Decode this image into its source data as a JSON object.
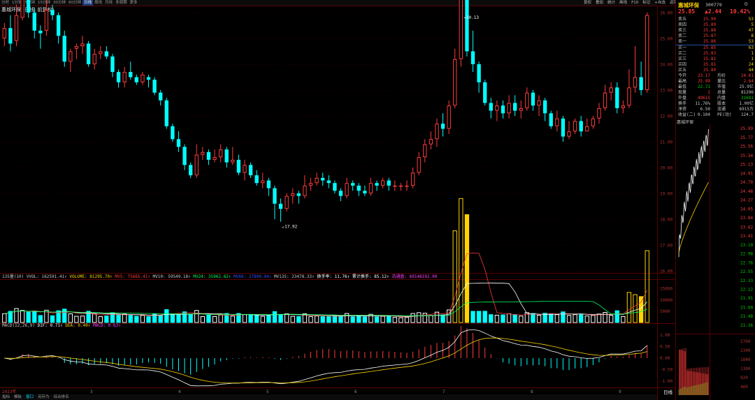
{
  "topbar": {
    "tabs": [
      "分时",
      "1分钟",
      "5分钟",
      "15分钟",
      "30分钟",
      "60分钟",
      "日线",
      "周线",
      "月线",
      "多周期",
      "更多"
    ],
    "active_tab": "日线",
    "right": [
      "复权",
      "叠加",
      "统计",
      "画线",
      "F10",
      "标记",
      "+自选",
      "返回"
    ]
  },
  "title": "惠城环保 (日线, 前复权)",
  "kline": {
    "type": "candlestick",
    "price_axis": [
      "26.00",
      "25.00",
      "24.00",
      "23.00",
      "22.00",
      "21.00",
      "20.00",
      "19.00",
      "18.00",
      "17.00",
      "16.00"
    ],
    "price_range": [
      16,
      26
    ],
    "high_label": "30.13",
    "low_label": "17.92",
    "up_color": "#ff3b3b",
    "down_color": "#00ffff",
    "candles": [
      [
        25.0,
        25.4,
        25.6,
        24.7
      ],
      [
        25.4,
        24.8,
        25.9,
        24.5
      ],
      [
        24.9,
        25.9,
        26.3,
        24.7
      ],
      [
        25.8,
        26.6,
        27.0,
        25.7
      ],
      [
        26.6,
        26.0,
        26.9,
        25.8
      ],
      [
        26.0,
        25.3,
        26.2,
        25.0
      ],
      [
        25.3,
        25.2,
        25.5,
        24.6
      ],
      [
        25.3,
        26.1,
        26.5,
        25.1
      ],
      [
        26.1,
        25.9,
        26.3,
        25.7
      ],
      [
        25.9,
        25.1,
        26.0,
        24.8
      ],
      [
        25.1,
        24.1,
        25.3,
        23.9
      ],
      [
        24.1,
        24.5,
        24.6,
        23.7
      ],
      [
        24.6,
        24.7,
        24.8,
        24.2
      ],
      [
        24.7,
        24.8,
        25.1,
        24.4
      ],
      [
        24.8,
        24.0,
        24.9,
        23.9
      ],
      [
        24.0,
        24.4,
        24.6,
        23.8
      ],
      [
        24.4,
        24.5,
        24.7,
        24.2
      ],
      [
        24.5,
        24.3,
        24.7,
        24.2
      ],
      [
        24.3,
        23.7,
        24.4,
        23.5
      ],
      [
        23.7,
        23.3,
        23.8,
        23.1
      ],
      [
        23.3,
        23.7,
        23.9,
        23.1
      ],
      [
        23.7,
        23.5,
        24.1,
        23.4
      ],
      [
        23.5,
        23.3,
        23.6,
        23.2
      ],
      [
        23.3,
        23.6,
        23.7,
        23.2
      ],
      [
        23.5,
        23.4,
        23.6,
        23.1
      ],
      [
        23.4,
        22.9,
        23.5,
        22.8
      ],
      [
        22.9,
        22.6,
        23.0,
        22.4
      ],
      [
        22.6,
        21.6,
        22.7,
        21.5
      ],
      [
        21.6,
        21.1,
        21.7,
        21.0
      ],
      [
        21.1,
        20.8,
        21.4,
        20.6
      ],
      [
        20.8,
        20.1,
        20.9,
        19.9
      ],
      [
        20.1,
        19.7,
        20.2,
        19.6
      ],
      [
        19.7,
        20.5,
        20.9,
        19.6
      ],
      [
        20.5,
        20.6,
        20.8,
        20.3
      ],
      [
        20.6,
        20.3,
        20.7,
        20.1
      ],
      [
        20.3,
        20.4,
        20.7,
        20.2
      ],
      [
        20.4,
        20.7,
        20.9,
        20.2
      ],
      [
        20.7,
        20.2,
        20.8,
        20.0
      ],
      [
        20.2,
        20.3,
        20.8,
        20.1
      ],
      [
        20.3,
        19.8,
        20.5,
        19.7
      ],
      [
        19.8,
        20.1,
        20.3,
        19.5
      ],
      [
        20.1,
        19.7,
        20.2,
        19.6
      ],
      [
        19.7,
        19.4,
        19.9,
        19.3
      ],
      [
        19.4,
        19.5,
        19.8,
        19.2
      ],
      [
        19.5,
        19.2,
        19.6,
        18.9
      ],
      [
        19.2,
        18.6,
        19.3,
        18.0
      ],
      [
        18.6,
        18.4,
        18.8,
        17.9
      ],
      [
        18.4,
        18.9,
        19.0,
        18.3
      ],
      [
        18.9,
        19.0,
        19.2,
        18.6
      ],
      [
        19.0,
        18.9,
        19.1,
        18.6
      ],
      [
        18.9,
        19.3,
        19.7,
        18.8
      ],
      [
        19.3,
        19.4,
        19.6,
        19.1
      ],
      [
        19.4,
        19.6,
        19.8,
        19.3
      ],
      [
        19.6,
        19.5,
        19.8,
        19.3
      ],
      [
        19.5,
        19.4,
        19.7,
        19.2
      ],
      [
        19.4,
        19.1,
        19.5,
        19.0
      ],
      [
        19.1,
        18.9,
        19.2,
        18.7
      ],
      [
        18.9,
        19.4,
        19.6,
        18.8
      ],
      [
        19.4,
        19.3,
        19.5,
        19.1
      ],
      [
        19.3,
        19.1,
        19.4,
        18.9
      ],
      [
        19.1,
        19.0,
        19.3,
        18.9
      ],
      [
        19.0,
        19.4,
        19.6,
        18.9
      ],
      [
        19.4,
        19.3,
        19.5,
        19.1
      ],
      [
        19.3,
        19.5,
        19.6,
        19.2
      ],
      [
        19.5,
        19.3,
        19.6,
        19.1
      ],
      [
        19.3,
        19.3,
        19.5,
        19.1
      ],
      [
        19.3,
        19.3,
        19.4,
        19.1
      ],
      [
        19.3,
        19.3,
        19.5,
        19.1
      ],
      [
        19.3,
        19.8,
        20.0,
        19.2
      ],
      [
        19.8,
        20.4,
        20.6,
        19.7
      ],
      [
        20.4,
        20.9,
        21.1,
        20.2
      ],
      [
        20.9,
        21.1,
        21.4,
        20.7
      ],
      [
        21.1,
        21.7,
        21.9,
        20.8
      ],
      [
        21.7,
        21.5,
        22.1,
        21.2
      ],
      [
        21.5,
        22.4,
        22.6,
        21.3
      ],
      [
        22.4,
        24.2,
        24.6,
        22.3
      ],
      [
        24.2,
        26.7,
        27.4,
        23.9
      ],
      [
        26.7,
        24.5,
        27.1,
        24.3
      ],
      [
        24.5,
        24.0,
        25.3,
        23.7
      ],
      [
        24.0,
        23.3,
        24.1,
        22.9
      ],
      [
        23.3,
        22.5,
        23.4,
        22.4
      ],
      [
        22.5,
        22.2,
        22.7,
        21.9
      ],
      [
        22.2,
        22.4,
        22.6,
        21.8
      ],
      [
        22.4,
        22.1,
        22.6,
        21.9
      ],
      [
        22.1,
        22.5,
        22.8,
        21.9
      ],
      [
        22.5,
        22.2,
        22.8,
        22.0
      ],
      [
        22.2,
        22.3,
        22.6,
        21.9
      ],
      [
        22.3,
        22.9,
        23.1,
        22.2
      ],
      [
        22.9,
        22.4,
        23.0,
        22.2
      ],
      [
        22.4,
        22.6,
        22.8,
        22.0
      ],
      [
        22.6,
        22.1,
        22.7,
        21.8
      ],
      [
        22.1,
        21.6,
        22.2,
        21.5
      ],
      [
        21.6,
        21.9,
        22.2,
        21.4
      ],
      [
        21.9,
        21.2,
        22.0,
        21.0
      ],
      [
        21.2,
        21.4,
        21.8,
        21.1
      ],
      [
        21.4,
        21.8,
        21.9,
        21.3
      ],
      [
        21.8,
        21.4,
        22.0,
        21.2
      ],
      [
        21.4,
        21.6,
        21.9,
        21.4
      ],
      [
        21.6,
        21.9,
        22.0,
        21.5
      ],
      [
        21.9,
        22.3,
        22.5,
        21.7
      ],
      [
        22.3,
        22.9,
        23.2,
        22.2
      ],
      [
        22.9,
        23.1,
        23.3,
        22.6
      ],
      [
        23.1,
        22.3,
        23.3,
        22.1
      ],
      [
        22.3,
        22.4,
        22.6,
        22.1
      ],
      [
        22.4,
        23.1,
        23.8,
        22.3
      ],
      [
        23.1,
        23.5,
        24.7,
        22.9
      ],
      [
        23.5,
        23.0,
        24.1,
        22.8
      ],
      [
        23.0,
        25.9,
        26.0,
        22.9
      ]
    ]
  },
  "indicators": {
    "vol_line": [
      {
        "text": "135量(10)",
        "color": "#c8c8c8"
      },
      {
        "text": "VVOL: 162591.41↑",
        "color": "#c8c8c8"
      },
      {
        "text": "VOLUME: 81295.70↑",
        "color": "#ffd400"
      },
      {
        "text": "MV5: 75665.41↑",
        "color": "#ff3b3b"
      },
      {
        "text": "MV10: 59549.18↑",
        "color": "#c8c8c8"
      },
      {
        "text": "MV24: 35962.62↑",
        "color": "#00ff60"
      },
      {
        "text": "MV60: 27800.04↑",
        "color": "#3050ff"
      },
      {
        "text": "MV135: 23478.33↑",
        "color": "#c8c8c8"
      },
      {
        "text": "换手率: 11.76↑",
        "color": "#ffffff"
      },
      {
        "text": "累计换手: 85.12↑",
        "color": "#ffffff"
      },
      {
        "text": "流通盘: 69148192.00",
        "color": "#ff40ff"
      }
    ],
    "macd_line": [
      {
        "text": "MACD(12,26,9)",
        "color": "#c8c8c8"
      },
      {
        "text": "DIF: 0.71↑",
        "color": "#ffffff"
      },
      {
        "text": "DEA: 0.40↑",
        "color": "#ffd400"
      },
      {
        "text": "MACD: 0.63↑",
        "color": "#ff40ff"
      }
    ],
    "vol_axis": [
      "15000",
      "10000",
      "5000"
    ],
    "macd_axis": [
      "1.00",
      "0.50",
      "0.00",
      "-0.50",
      "-1.00"
    ]
  },
  "timeline": [
    "2023年",
    "3",
    "4",
    "5",
    "6",
    "7",
    "8",
    "9"
  ],
  "bottombar": {
    "items": [
      "指标",
      "模板",
      "窗口",
      "另存为",
      "综合排名"
    ],
    "active": "窗口"
  },
  "panel": {
    "name": "惠城环保",
    "code": "300779",
    "price": "25.85",
    "change": "▲2.44",
    "pct": "10.42%",
    "ask": [
      {
        "label": "卖五",
        "price": "25.90",
        "vol": "53"
      },
      {
        "label": "卖四",
        "price": "25.89",
        "vol": "5"
      },
      {
        "label": "卖三",
        "price": "25.88",
        "vol": "47"
      },
      {
        "label": "卖二",
        "price": "25.87",
        "vol": "8"
      },
      {
        "label": "卖一",
        "price": "25.86",
        "vol": "53"
      }
    ],
    "bid": [
      {
        "label": "买一",
        "price": "25.85",
        "vol": "63"
      },
      {
        "label": "买二",
        "price": "25.83",
        "vol": "1"
      },
      {
        "label": "买三",
        "price": "25.82",
        "vol": "1"
      },
      {
        "label": "买四",
        "price": "25.81",
        "vol": "24"
      },
      {
        "label": "买五",
        "price": "25.80",
        "vol": "44"
      }
    ],
    "stats": [
      {
        "l1": "今开",
        "v1": "23.17",
        "c1": "#ff3b3b",
        "l2": "均价",
        "v2": "24.61",
        "c2": "#ff3b3b"
      },
      {
        "l1": "最高",
        "v1": "25.99",
        "c1": "#ff3b3b",
        "l2": "量比",
        "v2": "2.64",
        "c2": "#ff3b3b"
      },
      {
        "l1": "最低",
        "v1": "22.71",
        "c1": "#00d000",
        "l2": "市值",
        "v2": "25.9亿",
        "c2": "#c8c8c8"
      },
      {
        "l1": "现量",
        "v1": "2",
        "c1": "#ff3b3b",
        "l2": "总量",
        "v2": "81296",
        "c2": "#c8c8c8"
      },
      {
        "l1": "外盘",
        "v1": "49615",
        "c1": "#ff3b3b",
        "l2": "内盘",
        "v2": "31681",
        "c2": "#00d000"
      },
      {
        "l1": "换手",
        "v1": "11.76%",
        "c1": "#c8c8c8",
        "l2": "股本",
        "v2": "1.00亿",
        "c2": "#c8c8c8"
      },
      {
        "l1": "净资",
        "v1": "6.50",
        "c1": "#c8c8c8",
        "l2": "流通",
        "v2": "6915万",
        "c2": "#c8c8c8"
      },
      {
        "l1": "收益(二)",
        "v1": "0.104",
        "c1": "#c8c8c8",
        "l2": "PE(动)",
        "v2": "124.7",
        "c2": "#c8c8c8"
      }
    ],
    "tick_label": "惠城环保",
    "tick_axis": [
      "25.99",
      "25.77",
      "25.56",
      "25.34",
      "25.13",
      "24.91",
      "24.70",
      "24.48",
      "24.27",
      "24.05",
      "23.84",
      "23.62",
      "23.41",
      "23.19",
      "22.98",
      "22.76",
      "22.55",
      "22.33",
      "22.12",
      "21.91",
      "21.69",
      "21.48",
      "21.26"
    ],
    "tick_vol_axis": [
      "2760",
      "2300",
      "1840",
      "1380",
      "920",
      "460"
    ],
    "period_label": "日线"
  },
  "colors": {
    "up": "#ff3b3b",
    "down": "#00ffff",
    "grid": "#5a0000"
  }
}
